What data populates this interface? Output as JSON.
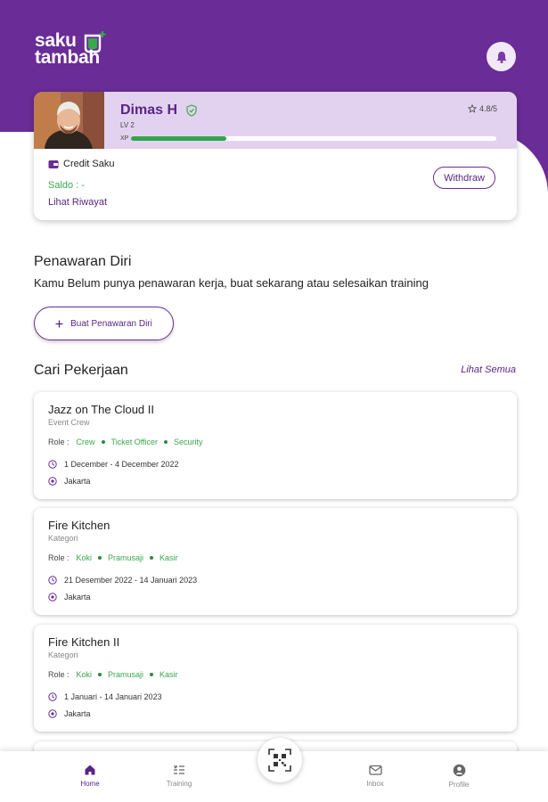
{
  "app": {
    "logo_line1": "saku",
    "logo_line2": "tambah"
  },
  "profile": {
    "name": "Dimas H",
    "level": "LV 2",
    "xp_label": "XP",
    "xp_progress": 0.26,
    "rating": "4.8/5",
    "credit_label": "Credit Saku",
    "saldo": "Saldo : -",
    "history_link": "Lihat Riwayat",
    "withdraw_label": "Withdraw"
  },
  "offer_section": {
    "title": "Penawaran Diri",
    "description": "Kamu Belum punya penawaran kerja, buat sekarang atau selesaikan training",
    "create_button": "Buat Penawaran Diri"
  },
  "jobs_section": {
    "title": "Cari Pekerjaan",
    "see_all": "Lihat Semua",
    "role_label": "Role :",
    "jobs": [
      {
        "title": "Jazz on The Cloud II",
        "category": "Event Crew",
        "roles": [
          "Crew",
          "Ticket Officer",
          "Security"
        ],
        "date": "1 December - 4 December 2022",
        "location": "Jakarta"
      },
      {
        "title": "Fire Kitchen",
        "category": "Kategori",
        "roles": [
          "Koki",
          "Pramusaji",
          "Kasir"
        ],
        "date": "21 Desember 2022 - 14 Januari 2023",
        "location": "Jakarta"
      },
      {
        "title": "Fire Kitchen II",
        "category": "Kategori",
        "roles": [
          "Koki",
          "Pramusaji",
          "Kasir"
        ],
        "date": "1 Januari - 14 Januari 2023",
        "location": "Jakarta"
      }
    ]
  },
  "nav": {
    "items": [
      {
        "label": "Home",
        "icon": "home-icon",
        "active": true
      },
      {
        "label": "Training",
        "icon": "training-icon",
        "active": false
      },
      {
        "label": "Inbox",
        "icon": "mail-icon",
        "active": false
      },
      {
        "label": "Profile",
        "icon": "profile-icon",
        "active": false
      }
    ],
    "center_icon": "qr-code-icon"
  },
  "colors": {
    "brand_purple": "#6a2c96",
    "accent_green": "#3aa84c",
    "profile_tint": "#e2d2ef"
  }
}
